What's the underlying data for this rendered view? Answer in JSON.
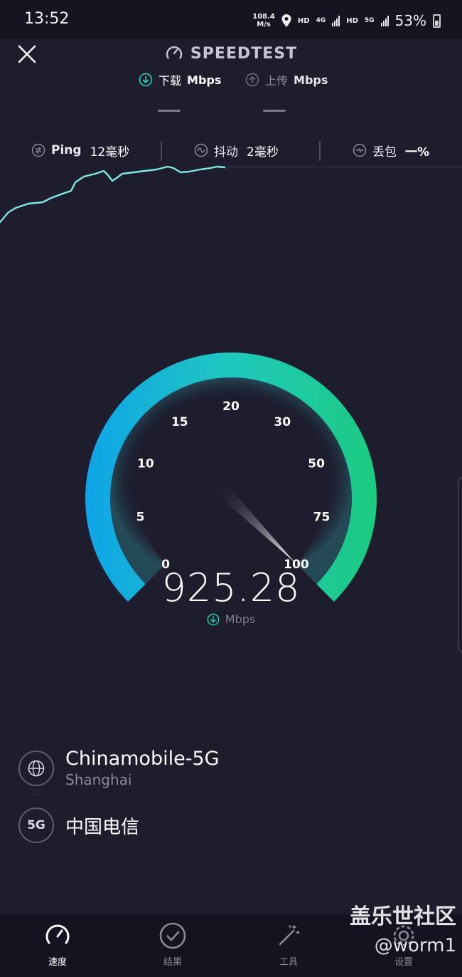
{
  "status_bar": {
    "time": "13:52",
    "net_speed_value": "108.4",
    "net_speed_unit": "M/s",
    "hd_label": "HD",
    "network_4g": "4G",
    "network_5g": "5G",
    "battery_percent": "53%"
  },
  "header": {
    "title": "SPEEDTEST",
    "download_label": "下载",
    "download_unit": "Mbps",
    "upload_label": "上传",
    "upload_unit": "Mbps"
  },
  "metrics": {
    "ping_label": "Ping",
    "ping_value": "12毫秒",
    "jitter_label": "抖动",
    "jitter_value": "2毫秒",
    "loss_label": "丢包",
    "loss_value": "一%"
  },
  "gauge": {
    "ticks": [
      "0",
      "5",
      "10",
      "15",
      "20",
      "30",
      "50",
      "75",
      "100"
    ],
    "current_value": "925.28",
    "unit": "Mbps",
    "needle_at_tick": "100"
  },
  "server": {
    "name": "Chinamobile-5G",
    "location": "Shanghai",
    "network_badge": "5G",
    "isp": "中国电信"
  },
  "nav": {
    "items": [
      {
        "label": "速度",
        "icon": "speedometer-icon"
      },
      {
        "label": "结果",
        "icon": "check-circle-icon"
      },
      {
        "label": "工具",
        "icon": "magic-wand-icon"
      },
      {
        "label": "设置",
        "icon": "gear-icon"
      }
    ]
  },
  "watermark": {
    "line1": "盖乐世社区",
    "line2": "@worm1"
  },
  "colors": {
    "background": "#1d1d2e",
    "accent_teal": "#1fd1b8",
    "accent_blue": "#12a6e8",
    "accent_green": "#1ecb86"
  }
}
